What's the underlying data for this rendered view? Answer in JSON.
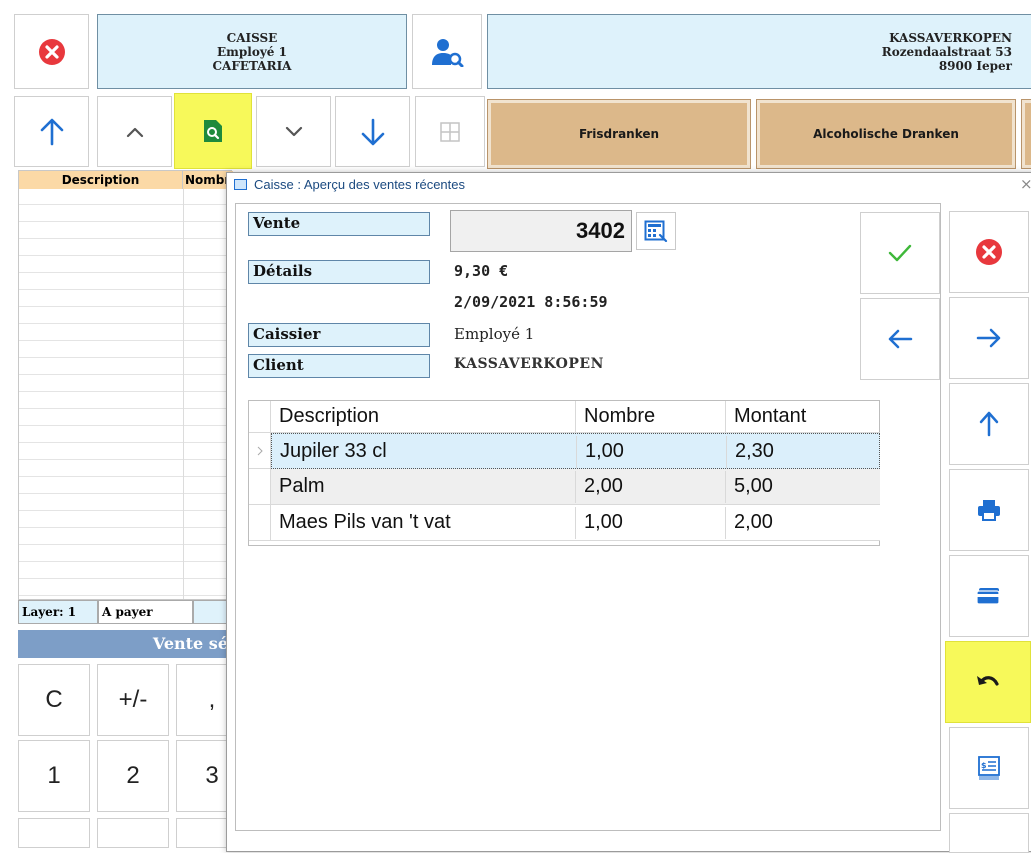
{
  "header": {
    "left_panel": {
      "line1": "CAISSE",
      "line2": "Employé 1",
      "line3": "CAFETARIA"
    },
    "right_panel": {
      "line1": "KASSAVERKOPEN",
      "line2": "Rozendaalstraat 53",
      "line3": "8900 Ieper"
    }
  },
  "categories": [
    "Frisdranken",
    "Alcoholische Dranken"
  ],
  "left_grid": {
    "col1": "Description",
    "col2": "Nombr"
  },
  "status_bar": {
    "layer": "Layer: 1",
    "to_pay": "A payer",
    "extra": "("
  },
  "sale_bar": "Vente sé",
  "keypad": {
    "row1": [
      "C",
      "+/-",
      ","
    ],
    "row2": [
      "1",
      "2",
      "3"
    ]
  },
  "dialog": {
    "title": "Caisse : Aperçu des ventes récentes",
    "close": "×",
    "labels": {
      "sale": "Vente",
      "details": "Détails",
      "cashier": "Caissier",
      "client": "Client"
    },
    "sale_number": "3402",
    "amount": "9,30 €",
    "datetime": "2/09/2021 8:56:59",
    "cashier": "Employé 1",
    "client": "KASSAVERKOPEN",
    "table": {
      "headers": [
        "Description",
        "Nombre",
        "Montant"
      ],
      "rows": [
        [
          "Jupiler 33 cl",
          "1,00",
          "2,30"
        ],
        [
          "Palm",
          "2,00",
          "5,00"
        ],
        [
          "Maes Pils van 't vat",
          "1,00",
          "2,00"
        ]
      ]
    }
  },
  "colors": {
    "accent_blue": "#1f6fd1",
    "highlight_yellow": "#f7f95a",
    "panel_blue": "#def2fb",
    "category_tan": "#dcb88a",
    "close_red": "#e8383d",
    "confirm_green": "#3fb83a",
    "selected_row": "#dbeffb"
  }
}
